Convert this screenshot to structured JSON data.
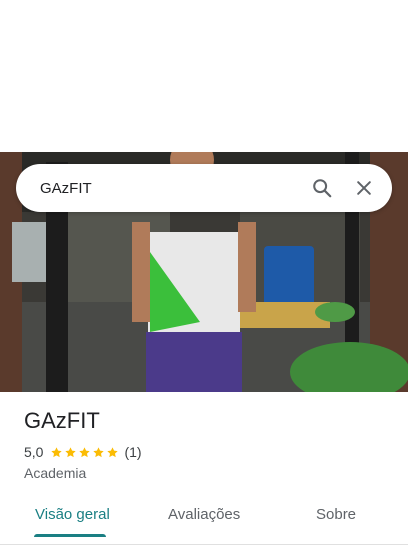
{
  "search": {
    "query": "GAzFIT"
  },
  "place": {
    "name": "GAzFIT",
    "rating": "5,0",
    "stars": 5,
    "review_count": "(1)",
    "category": "Academia"
  },
  "tabs": [
    {
      "label": "Visão geral",
      "active": true
    },
    {
      "label": "Avaliações",
      "active": false
    },
    {
      "label": "Sobre",
      "active": false
    }
  ],
  "colors": {
    "accent": "#1a7f83",
    "star": "#fbbc04"
  }
}
